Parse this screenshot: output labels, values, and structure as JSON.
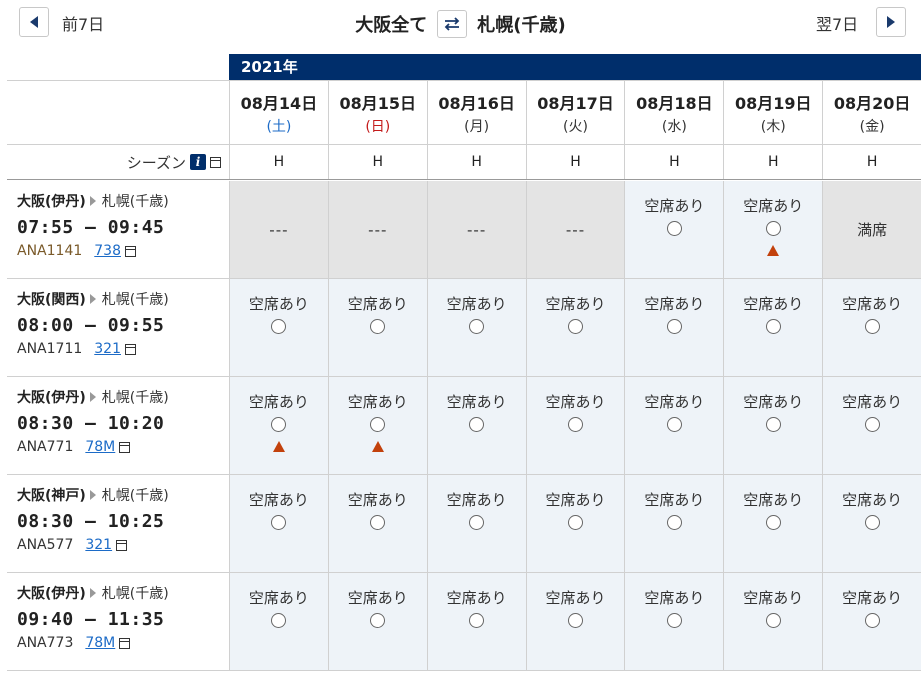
{
  "nav": {
    "prev_label": "前7日",
    "next_label": "翌7日",
    "origin": "大阪全て",
    "destination": "札幌(千歳)"
  },
  "year": "2021年",
  "season_label": "シーズン",
  "days": [
    {
      "date": "08月14日",
      "dow": "(土)",
      "season": "H"
    },
    {
      "date": "08月15日",
      "dow": "(日)",
      "season": "H"
    },
    {
      "date": "08月16日",
      "dow": "(月)",
      "season": "H"
    },
    {
      "date": "08月17日",
      "dow": "(火)",
      "season": "H"
    },
    {
      "date": "08月18日",
      "dow": "(水)",
      "season": "H"
    },
    {
      "date": "08月19日",
      "dow": "(木)",
      "season": "H"
    },
    {
      "date": "08月20日",
      "dow": "(金)",
      "season": "H"
    }
  ],
  "labels": {
    "available": "空席あり",
    "full": "満席",
    "none": "---"
  },
  "flights": [
    {
      "from": "大阪(伊丹)",
      "to": "札幌(千歳)",
      "time": "07:55 – 09:45",
      "flight_no": "ANA1141",
      "aircraft": "738",
      "cells": [
        "none",
        "none",
        "none",
        "none",
        "avail",
        "avail_warn",
        "full"
      ]
    },
    {
      "from": "大阪(関西)",
      "to": "札幌(千歳)",
      "time": "08:00 – 09:55",
      "flight_no": "ANA1711",
      "aircraft": "321",
      "cells": [
        "avail",
        "avail",
        "avail",
        "avail",
        "avail",
        "avail",
        "avail"
      ]
    },
    {
      "from": "大阪(伊丹)",
      "to": "札幌(千歳)",
      "time": "08:30 – 10:20",
      "flight_no": "ANA771",
      "aircraft": "78M",
      "cells": [
        "avail_warn",
        "avail_warn",
        "avail",
        "avail",
        "avail",
        "avail",
        "avail"
      ]
    },
    {
      "from": "大阪(神戸)",
      "to": "札幌(千歳)",
      "time": "08:30 – 10:25",
      "flight_no": "ANA577",
      "aircraft": "321",
      "cells": [
        "avail",
        "avail",
        "avail",
        "avail",
        "avail",
        "avail",
        "avail"
      ]
    },
    {
      "from": "大阪(伊丹)",
      "to": "札幌(千歳)",
      "time": "09:40 – 11:35",
      "flight_no": "ANA773",
      "aircraft": "78M",
      "cells": [
        "avail",
        "avail",
        "avail",
        "avail",
        "avail",
        "avail",
        "avail"
      ]
    }
  ]
}
